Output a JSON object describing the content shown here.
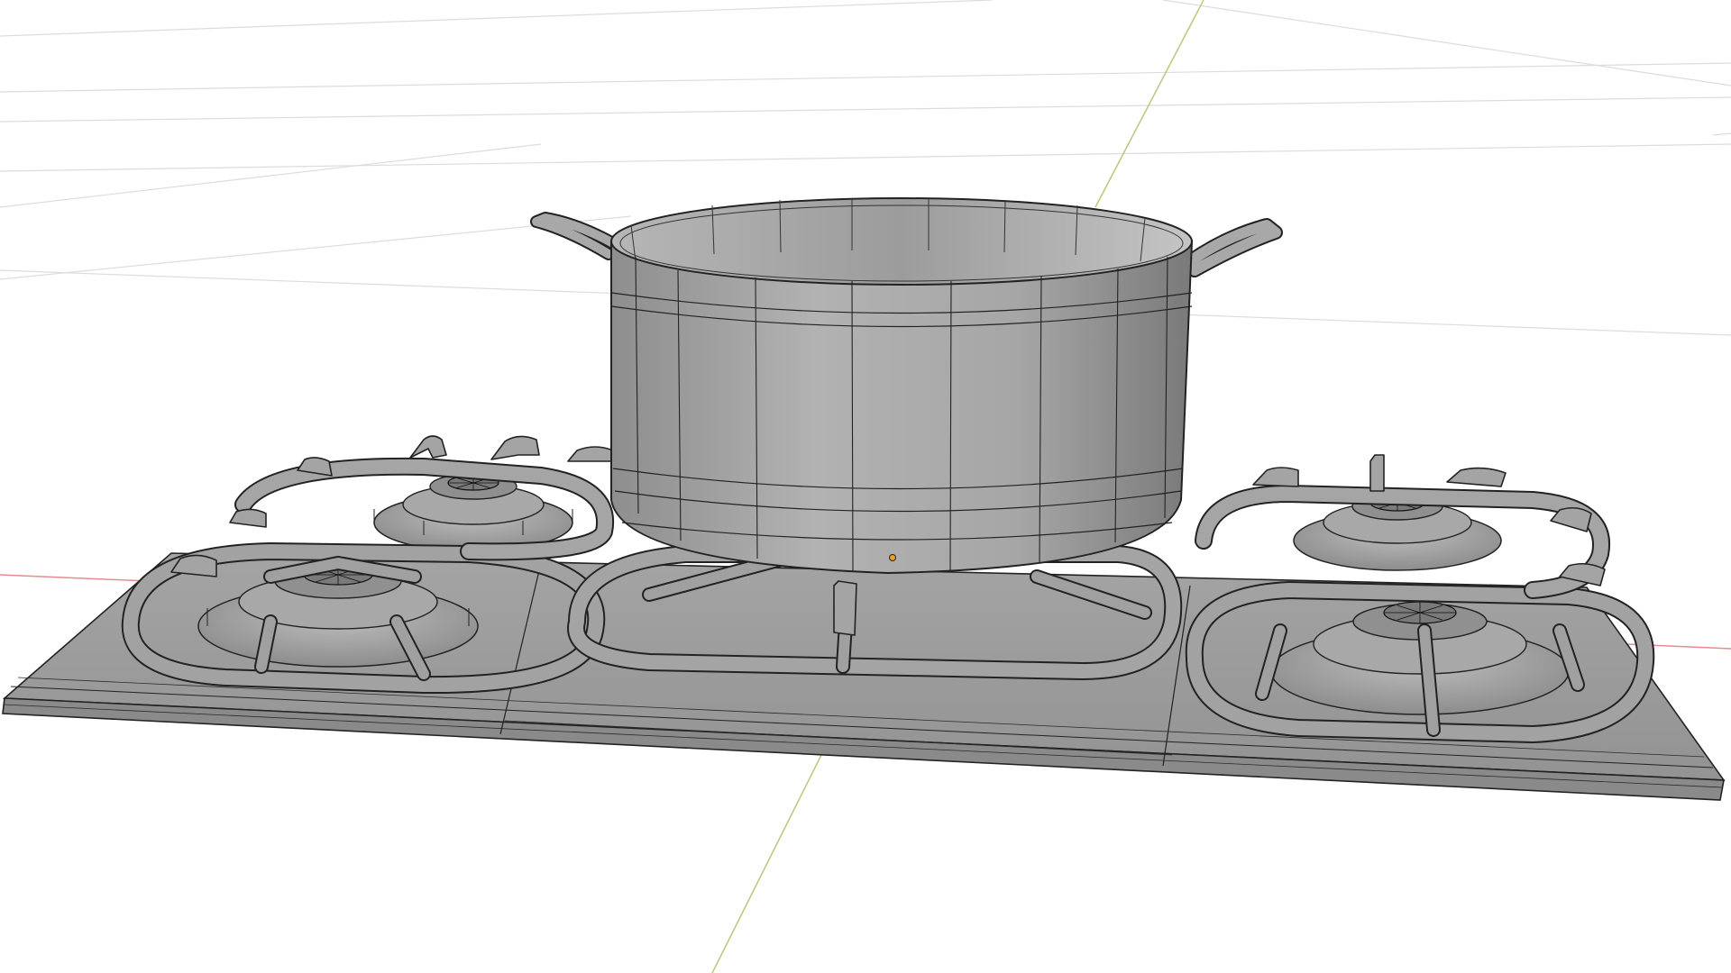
{
  "viewport": {
    "type": "3d-viewport",
    "shading": "solid-wireframe",
    "background_color": "#ffffff",
    "grid_color": "#d9d9d9",
    "x_axis_color": "#e88a8f",
    "y_axis_color": "#b9c77a",
    "mesh_color": "#9a9a9a",
    "wire_color": "#1e1e1e",
    "origin_color": "#f0a020"
  },
  "scene": {
    "objects": [
      {
        "name": "pot",
        "kind": "cooking-pot",
        "handles": 2
      },
      {
        "name": "hob",
        "kind": "gas-stove-top",
        "burners": 4,
        "grates": 3
      }
    ]
  }
}
